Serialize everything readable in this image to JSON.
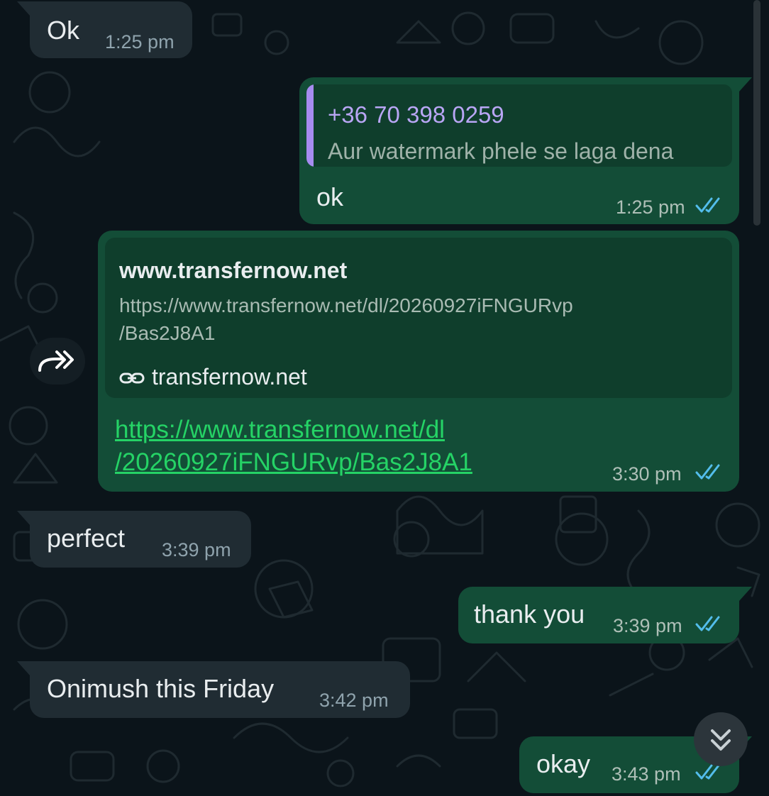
{
  "colors": {
    "background": "#0b141a",
    "incoming_bubble": "#202c33",
    "outgoing_bubble": "#134d37",
    "read_ticks": "#53bdeb",
    "link": "#25d366",
    "quote_accent": "#a68cf0"
  },
  "messages": [
    {
      "direction": "incoming",
      "text": "Ok",
      "time": "1:25 pm"
    },
    {
      "direction": "outgoing",
      "quoted": {
        "sender": "+36 70 398 0259",
        "text": "Aur watermark phele se laga dena"
      },
      "text": "ok",
      "time": "1:25 pm",
      "status_icon": "double-check-icon"
    },
    {
      "direction": "outgoing",
      "link_preview": {
        "title": "www.transfernow.net",
        "url_line1": "https://www.transfernow.net/dl/20260927iFNGURvp",
        "url_line2": "/Bas2J8A1",
        "domain": "transfernow.net",
        "domain_icon": "link-icon"
      },
      "link_line1": "https://www.transfernow.net/dl",
      "link_line2": "/20260927iFNGURvp/Bas2J8A1",
      "time": "3:30 pm",
      "status_icon": "double-check-icon"
    },
    {
      "direction": "incoming",
      "text": "perfect",
      "time": "3:39 pm"
    },
    {
      "direction": "outgoing",
      "text": "thank you",
      "time": "3:39 pm",
      "status_icon": "double-check-icon"
    },
    {
      "direction": "incoming",
      "text": "Onimush this Friday",
      "time": "3:42 pm"
    },
    {
      "direction": "outgoing",
      "text": "okay",
      "time": "3:43 pm",
      "status_icon": "double-check-icon"
    }
  ],
  "controls": {
    "forward_icon": "forward-icon",
    "scroll_down_icon": "chevron-double-down-icon"
  }
}
